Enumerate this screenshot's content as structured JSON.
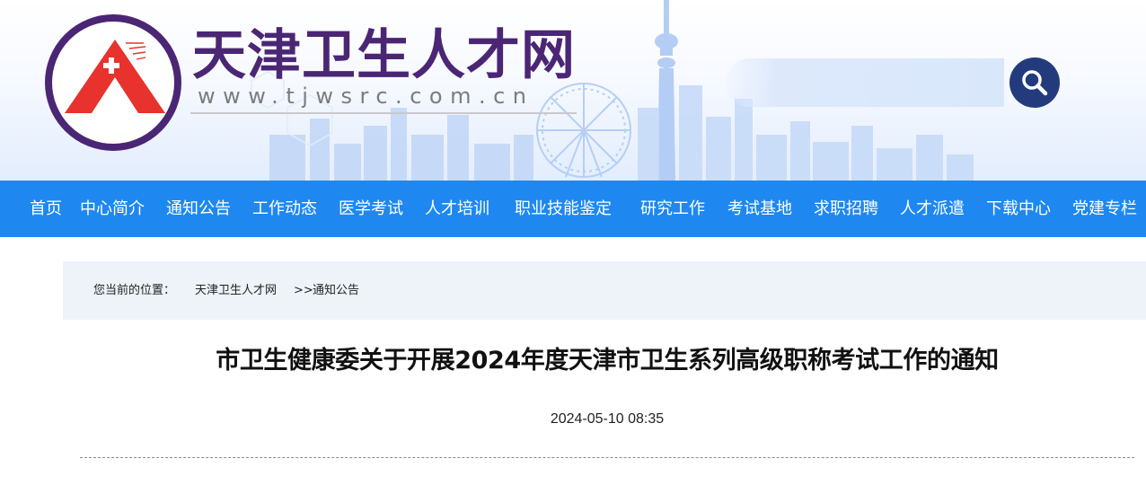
{
  "header": {
    "site_name": "天津卫生人才网",
    "site_url": "www.tjwsrc.com.cn",
    "search": {
      "placeholder": "",
      "value": "",
      "button_icon": "search-icon"
    },
    "colors": {
      "brand_purple": "#4b2674",
      "emblem_red": "#e8322d",
      "search_button": "#233b7c"
    }
  },
  "nav": {
    "background": "#1e88f0",
    "items": [
      {
        "label": "首页"
      },
      {
        "label": "中心简介"
      },
      {
        "label": "通知公告"
      },
      {
        "label": "工作动态"
      },
      {
        "label": "医学考试"
      },
      {
        "label": "人才培训"
      },
      {
        "label": "职业技能鉴定"
      },
      {
        "label": "研究工作"
      },
      {
        "label": "考试基地"
      },
      {
        "label": "求职招聘"
      },
      {
        "label": "人才派遣"
      },
      {
        "label": "下载中心"
      },
      {
        "label": "党建专栏"
      }
    ]
  },
  "breadcrumb": {
    "prefix": "您当前的位置：",
    "items": [
      {
        "label": "天津卫生人才网"
      },
      {
        "label": "通知公告"
      }
    ],
    "separator": ">>"
  },
  "article": {
    "title": "市卫生健康委关于开展2024年度天津市卫生系列高级职称考试工作的通知",
    "date": "2024-05-10 08:35"
  }
}
